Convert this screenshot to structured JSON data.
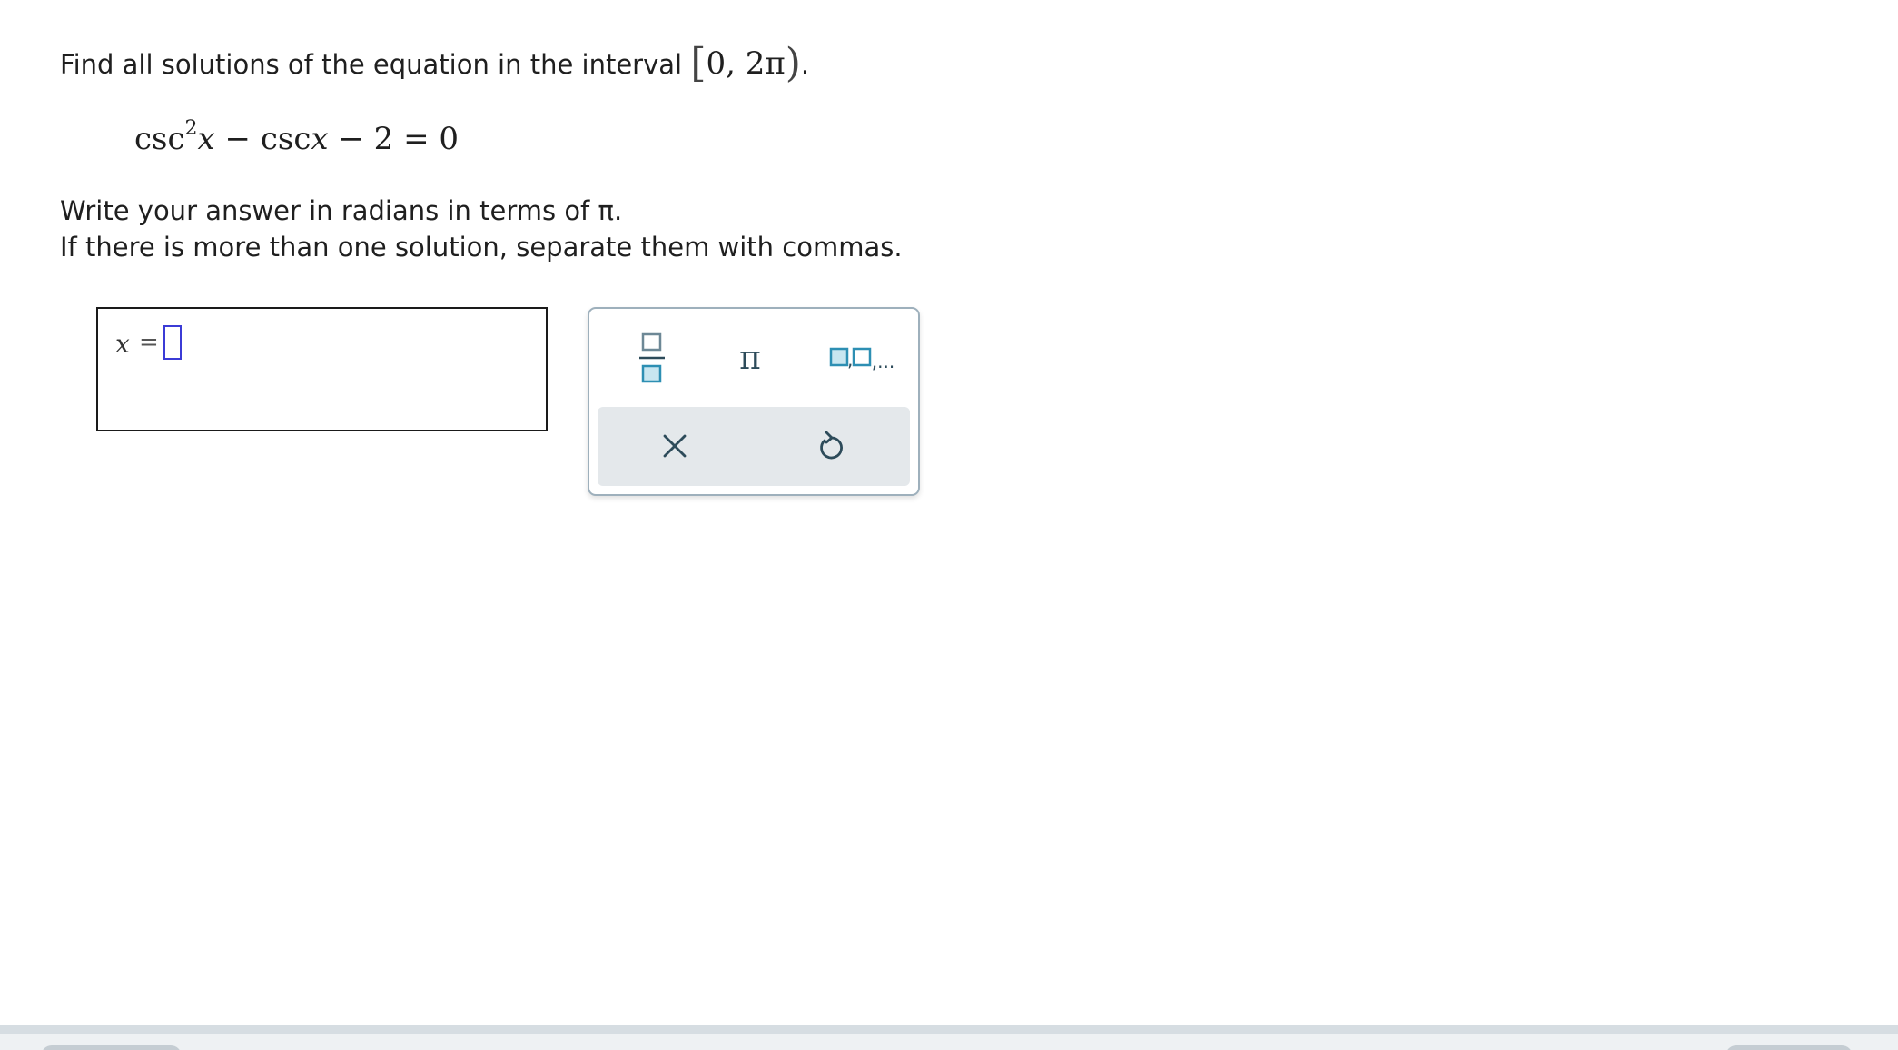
{
  "question": {
    "prompt": "Find all solutions of the equation in the interval",
    "interval_open": "[",
    "interval_body": "0, 2π",
    "interval_close": ")",
    "period": ".",
    "equation": {
      "fn1": "csc",
      "power": "2",
      "var1": "x",
      "minus1": " − ",
      "fn2": "csc",
      "var2": "x",
      "rest": " − 2 = 0"
    },
    "instruction_1": "Write your answer in radians in terms of π.",
    "instruction_2": "If there is more than one solution, separate them with commas."
  },
  "answer": {
    "variable": "x",
    "equals": "=",
    "value": ""
  },
  "keypad": {
    "keys": [
      {
        "name": "fraction",
        "icon": "fraction-icon"
      },
      {
        "name": "pi",
        "symbol": "π"
      },
      {
        "name": "list",
        "icon": "list-icon",
        "label": ",..."
      }
    ],
    "actions": [
      {
        "name": "clear",
        "icon": "close-icon"
      },
      {
        "name": "undo",
        "icon": "undo-icon"
      }
    ]
  },
  "colors": {
    "accent": "#2d8fb3",
    "input_cursor": "#3b3bd6",
    "keypad_border": "#9eb0bc",
    "action_bar": "#e4e8eb"
  }
}
